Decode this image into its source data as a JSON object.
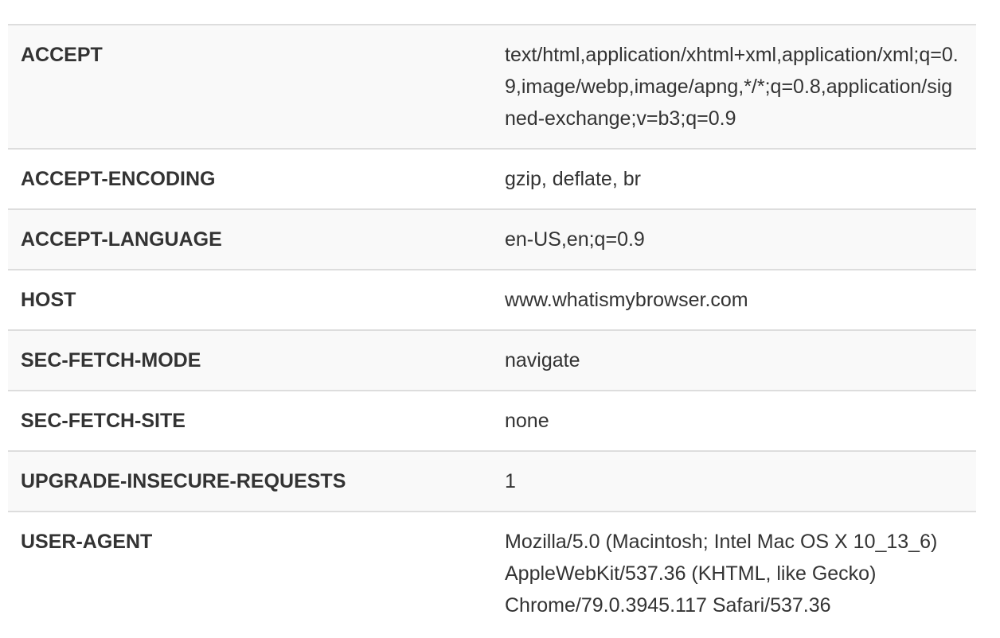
{
  "headers": [
    {
      "name": "ACCEPT",
      "value": "text/html,application/xhtml+xml,application/xml;q=0.9,image/webp,image/apng,*/*;q=0.8,application/signed-exchange;v=b3;q=0.9"
    },
    {
      "name": "ACCEPT-ENCODING",
      "value": "gzip, deflate, br"
    },
    {
      "name": "ACCEPT-LANGUAGE",
      "value": "en-US,en;q=0.9"
    },
    {
      "name": "HOST",
      "value": "www.whatismybrowser.com"
    },
    {
      "name": "SEC-FETCH-MODE",
      "value": "navigate"
    },
    {
      "name": "SEC-FETCH-SITE",
      "value": "none"
    },
    {
      "name": "UPGRADE-INSECURE-REQUESTS",
      "value": "1"
    },
    {
      "name": "USER-AGENT",
      "value": "Mozilla/5.0 (Macintosh; Intel Mac OS X 10_13_6) AppleWebKit/537.36 (KHTML, like Gecko) Chrome/79.0.3945.117 Safari/537.36"
    }
  ]
}
